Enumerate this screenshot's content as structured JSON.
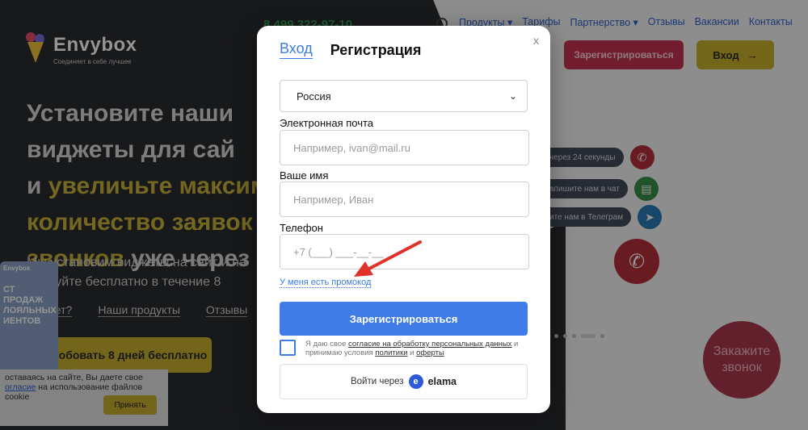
{
  "background": {
    "logo": {
      "name": "Envybox",
      "tagline": "Соединяет в себе лучшее"
    },
    "phone": "8 499 322-97-10",
    "nav": [
      "Продукты ▾",
      "Тарифы",
      "Партнерство ▾",
      "Отзывы",
      "Вакансии",
      "Контакты"
    ],
    "register_button": "Зарегистрироваться",
    "login_button": "Вход",
    "hero_lines": [
      {
        "a": "Установите наши",
        "b": ""
      },
      {
        "a": "виджеты для сай",
        "b": ""
      },
      {
        "a": "и ",
        "b": "увеличьте максим"
      },
      {
        "a": "",
        "b": "количество заявок в"
      },
      {
        "a": "звонков",
        "b": " уже через 9"
      }
    ],
    "hero_sub": [
      "Мы установим виджеты на сайт и на",
      "пробуйте бесплатно в течение 8"
    ],
    "hero_links": [
      "ает?",
      "Наши продукты",
      "Отзывы"
    ],
    "try_button": "пробовать 8 дней бесплатно",
    "promo_card": {
      "brand": "Envybox",
      "text": "СТ ПРОДАЖ ЛОЯЛЬНЫХ ИЕНТОВ"
    },
    "cookie": {
      "line1": "оставаясь на сайте, Вы даете свое",
      "link": "огласие",
      "line2": " на использование файлов cookie",
      "ok": "Принять"
    },
    "widgets": [
      "через 24 секунды",
      "апишите нам в чат",
      "ите нам в Телеграм"
    ],
    "callback": "Закажите звонок"
  },
  "modal": {
    "tab_login": "Вход",
    "tab_register": "Регистрация",
    "close": "x",
    "country": "Россия",
    "email_label": "Электронная почта",
    "email_placeholder": "Например, ivan@mail.ru",
    "name_label": "Ваше имя",
    "name_placeholder": "Например, Иван",
    "phone_label": "Телефон",
    "phone_placeholder": "+7 (___) ___-__-__",
    "promo_link": "У меня есть промокод",
    "submit": "Зарегистрироваться",
    "consent_pre": "Я даю свое ",
    "consent_link1": "согласие на обработку персональных данных",
    "consent_mid": " и принимаю условия ",
    "consent_link2": "политики",
    "consent_and": " и ",
    "consent_link3": "оферты",
    "elama_prefix": "Войти через",
    "elama_name": "elama"
  },
  "colors": {
    "accent": "#3f7ce8",
    "annotation_arrow": "#e0322a"
  }
}
